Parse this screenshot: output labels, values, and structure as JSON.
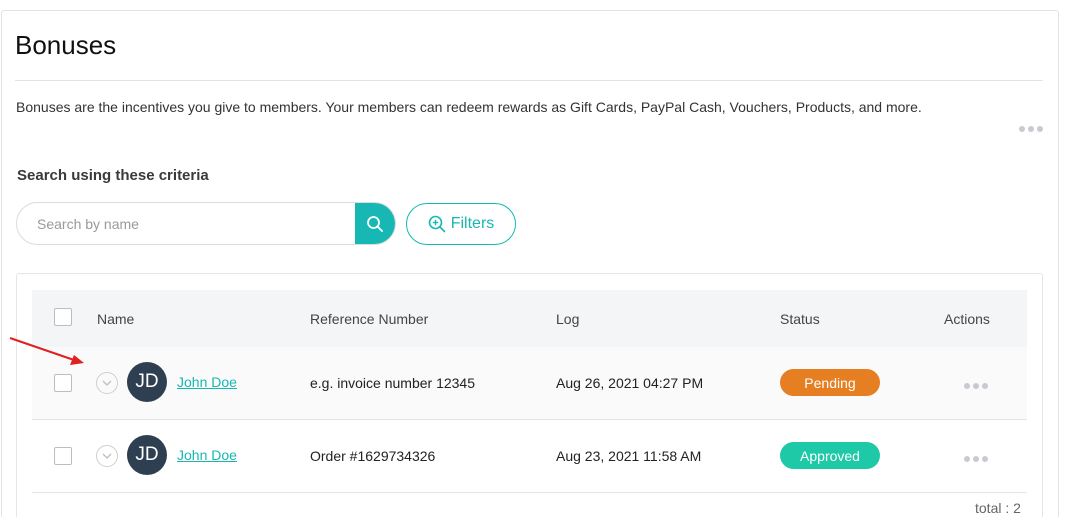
{
  "page": {
    "title": "Bonuses",
    "description": "Bonuses are the incentives you give to members. Your members can redeem rewards as Gift Cards, PayPal Cash, Vouchers, Products, and more."
  },
  "search": {
    "heading": "Search using these criteria",
    "placeholder": "Search by name",
    "value": "",
    "filters_label": "Filters"
  },
  "table": {
    "columns": {
      "name": "Name",
      "reference": "Reference Number",
      "log": "Log",
      "status": "Status",
      "actions": "Actions"
    },
    "rows": [
      {
        "initials": "JD",
        "name": "John Doe",
        "reference": "e.g. invoice number 12345",
        "log": "Aug 26, 2021 04:27 PM",
        "status": "Pending",
        "status_color": "#e67e22"
      },
      {
        "initials": "JD",
        "name": "John Doe",
        "reference": "Order #1629734326",
        "log": "Aug 23, 2021 11:58 AM",
        "status": "Approved",
        "status_color": "#1dc9a6"
      }
    ],
    "total_label": "total : 2"
  },
  "colors": {
    "accent": "#17b8b3",
    "avatar_bg": "#2f3f52",
    "annotation_arrow": "#e02020"
  }
}
